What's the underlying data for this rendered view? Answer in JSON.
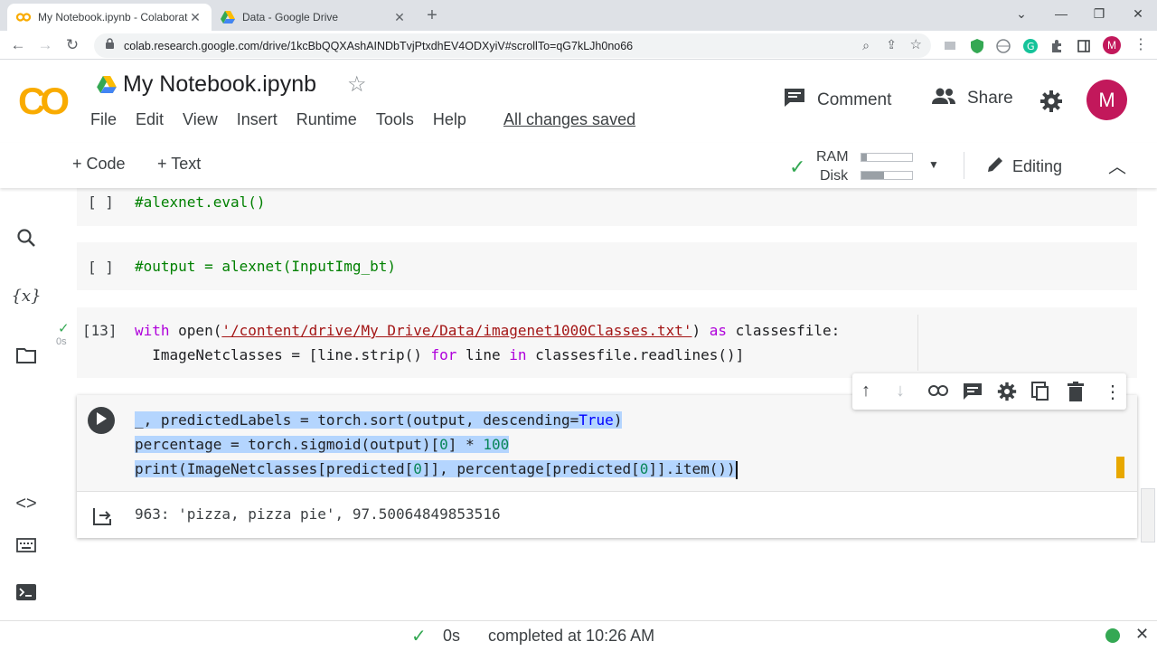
{
  "browser": {
    "tabs": [
      {
        "title": "My Notebook.ipynb - Colaborato",
        "active": true,
        "icon": "colab-icon"
      },
      {
        "title": "Data - Google Drive",
        "active": false,
        "icon": "drive-icon"
      }
    ],
    "url": "colab.research.google.com/drive/1kcBbQQXAshAINDbTvjPtxdhEV4ODXyiV#scrollTo=qG7kLJh0no66",
    "profile_initial": "M"
  },
  "header": {
    "logo": "CO",
    "notebook_title": "My Notebook.ipynb",
    "menu": [
      "File",
      "Edit",
      "View",
      "Insert",
      "Runtime",
      "Tools",
      "Help"
    ],
    "save_status": "All changes saved",
    "comment_label": "Comment",
    "share_label": "Share",
    "avatar_initial": "M"
  },
  "toolbar": {
    "add_code": "+ Code",
    "add_text": "+ Text",
    "ram_label": "RAM",
    "disk_label": "Disk",
    "ram_level": 0.1,
    "disk_level": 0.45,
    "editing_label": "Editing"
  },
  "cells": [
    {
      "prompt": "[ ]",
      "code": "#alexnet.eval()"
    },
    {
      "prompt": "[ ]",
      "code": "#output = alexnet(InputImg_bt)"
    },
    {
      "prompt": "[13]",
      "exec_time": "0s",
      "line1_kw": "with",
      "line1_fn": " open(",
      "line1_str": "'/content/drive/My Drive/Data/imagenet1000Classes.txt'",
      "line1_rest": ") ",
      "line1_kw2": "as",
      "line1_end": " classesfile:",
      "line2_a": "  ImageNetclasses = [line.strip() ",
      "line2_kw": "for",
      "line2_b": " line ",
      "line2_kw2": "in",
      "line2_c": " classesfile.readlines()]"
    },
    {
      "active": true,
      "line1_a": "_, predictedLabels = torch.sort(output, descending=",
      "line1_kw": "True",
      "line1_b": ")",
      "line2_a": "percentage = torch.sigmoid(output)[",
      "line2_n1": "0",
      "line2_b": "] * ",
      "line2_n2": "100",
      "line3_a": "print(ImageNetclasses[predicted[",
      "line3_n1": "0",
      "line3_b": "]], percentage[predicted[",
      "line3_n2": "0",
      "line3_c": "]].item())",
      "output": "963: 'pizza, pizza pie', 97.50064849853516"
    }
  ],
  "status": {
    "duration": "0s",
    "completed": "completed at 10:26 AM"
  },
  "colors": {
    "accent": "#f9ab00",
    "check": "#34a853",
    "keyword": "#af00db",
    "string": "#a31515"
  }
}
